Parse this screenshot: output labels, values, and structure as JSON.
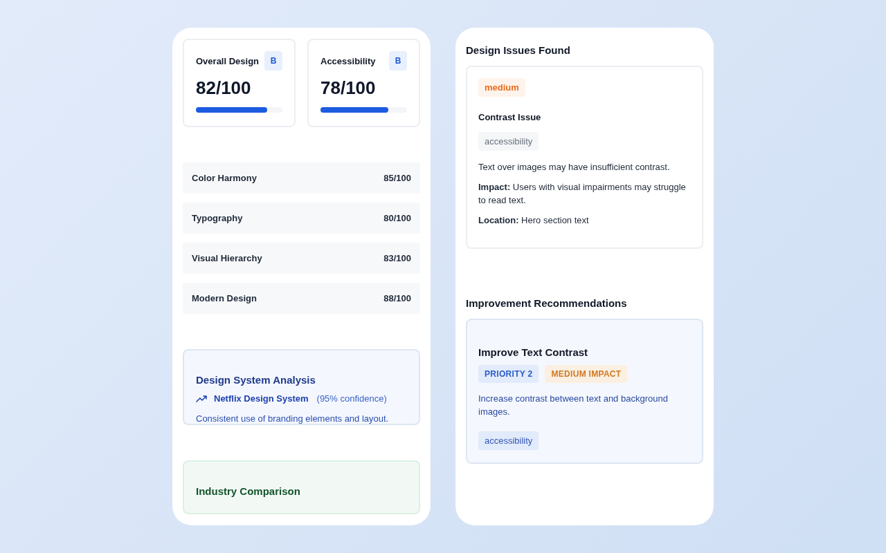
{
  "scores": [
    {
      "label": "Overall Design",
      "grade": "B",
      "value": "82/100",
      "level": 0.82
    },
    {
      "label": "Accessibility",
      "grade": "B",
      "value": "78/100",
      "level": 0.78
    }
  ],
  "metrics": [
    {
      "name": "Color Harmony",
      "value": "85/100"
    },
    {
      "name": "Typography",
      "value": "80/100"
    },
    {
      "name": "Visual Hierarchy",
      "value": "83/100"
    },
    {
      "name": "Modern Design",
      "value": "88/100"
    }
  ],
  "design_system": {
    "title": "Design System Analysis",
    "system": "Netflix Design System",
    "confidence": "(95% confidence)",
    "description": "Consistent use of branding elements and layout."
  },
  "industry_comparison": {
    "title": "Industry Comparison"
  },
  "issues": {
    "title": "Design Issues Found",
    "items": [
      {
        "severity": "medium",
        "title": "Contrast Issue",
        "category": "accessibility",
        "description": "Text over images may have insufficient contrast.",
        "impact": "**Impact:** Users with visual impairments may struggle to read text.",
        "location": "**Location:** Hero section text"
      }
    ]
  },
  "recommendations": {
    "title": "Improvement Recommendations",
    "items": [
      {
        "title": "Improve Text Contrast",
        "priority": "PRIORITY 2",
        "impact": "MEDIUM IMPACT",
        "description": "Increase contrast between text and background images.",
        "tag": "accessibility"
      }
    ]
  }
}
